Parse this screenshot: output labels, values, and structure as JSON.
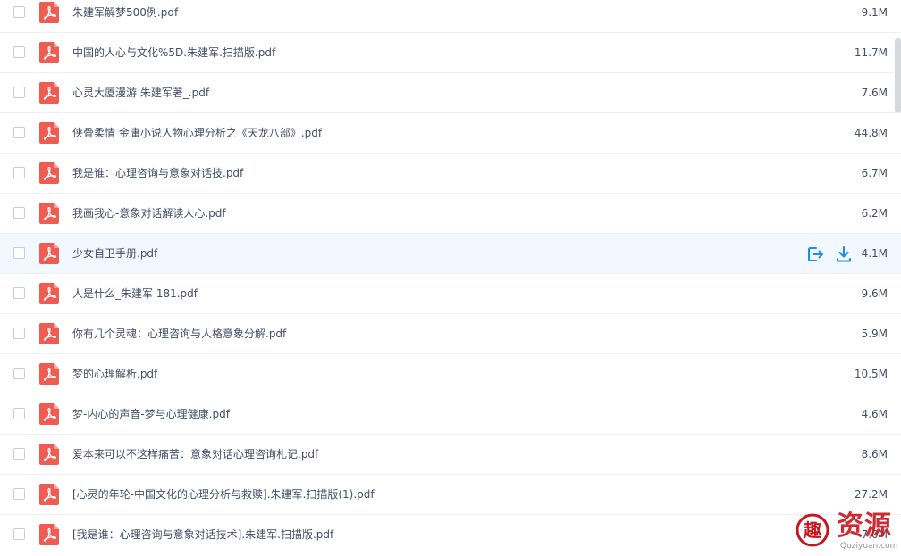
{
  "files": [
    {
      "name": "朱建军解梦500例.pdf",
      "size": "9.1M"
    },
    {
      "name": "中国的人心与文化%5D.朱建军.扫描版.pdf",
      "size": "11.7M"
    },
    {
      "name": "心灵大厦漫游 朱建军著_.pdf",
      "size": "7.6M"
    },
    {
      "name": "侠骨柔情 金庸小说人物心理分析之《天龙八部》.pdf",
      "size": "44.8M"
    },
    {
      "name": "我是谁：心理咨询与意象对话技.pdf",
      "size": "6.7M"
    },
    {
      "name": "我画我心-意象对话解读人心.pdf",
      "size": "6.2M"
    },
    {
      "name": "少女自卫手册.pdf",
      "size": "4.1M"
    },
    {
      "name": "人是什么_朱建军 181.pdf",
      "size": "9.6M"
    },
    {
      "name": "你有几个灵魂：心理咨询与人格意象分解.pdf",
      "size": "5.9M"
    },
    {
      "name": "梦的心理解析.pdf",
      "size": "10.5M"
    },
    {
      "name": "梦-内心的声音-梦与心理健康.pdf",
      "size": "4.6M"
    },
    {
      "name": "爱本来可以不这样痛苦：意象对话心理咨询札记.pdf",
      "size": "8.6M"
    },
    {
      "name": "[心灵的年轮-中国文化的心理分析与救赎].朱建军.扫描版(1).pdf",
      "size": "27.2M"
    },
    {
      "name": "[我是谁：心理咨询与意象对话技术].朱建军.扫描版.pdf",
      "size": "7.0M"
    }
  ],
  "hover_row_index": 6,
  "icons": {
    "file": "pdf-file-icon",
    "share": "share-icon",
    "download": "download-icon"
  },
  "colors": {
    "pdf_red": "#f05b52",
    "action_blue": "#1f8ee8",
    "text": "#424e67",
    "watermark_red": "#c8161d"
  },
  "watermark": {
    "text": "资源",
    "sub": "Quziyuan.com"
  }
}
